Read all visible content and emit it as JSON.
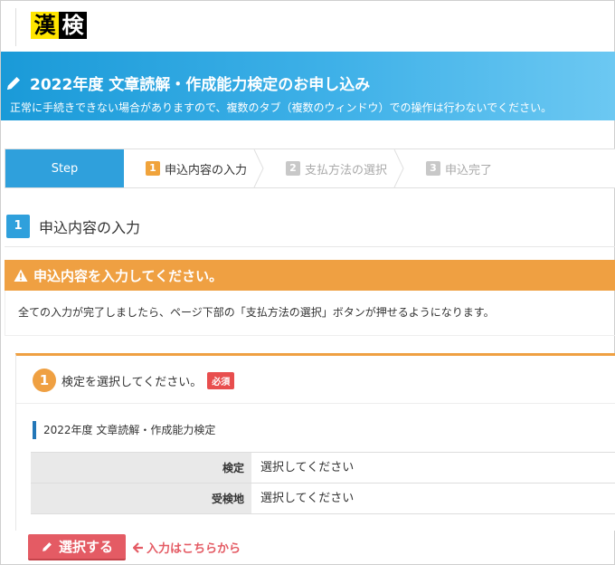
{
  "logo": {
    "char1": "漢",
    "char2": "検"
  },
  "banner": {
    "title": "2022年度 文章読解・作成能力検定のお申し込み",
    "note": "正常に手続きできない場合がありますので、複数のタブ（複数のウィンドウ）での操作は行わないでください。"
  },
  "steps": {
    "label": "Step",
    "items": [
      {
        "num": "1",
        "label": "申込内容の入力",
        "active": true
      },
      {
        "num": "2",
        "label": "支払方法の選択",
        "active": false
      },
      {
        "num": "3",
        "label": "申込完了",
        "active": false
      }
    ]
  },
  "section": {
    "num": "1",
    "title": "申込内容の入力"
  },
  "alert": {
    "title": "申込内容を入力してください。",
    "body": "全ての入力が完了しましたら、ページ下部の「支払方法の選択」ボタンが押せるようになります。"
  },
  "question": {
    "num": "1",
    "text": "検定を選択してください。",
    "required": "必須",
    "subtitle": "2022年度 文章読解・作成能力検定",
    "rows": [
      {
        "label": "検定",
        "value": "選択してください"
      },
      {
        "label": "受検地",
        "value": "選択してください"
      }
    ]
  },
  "actions": {
    "select_label": "選択する",
    "hint": "入力はこちらから"
  },
  "colors": {
    "brand_blue": "#2fa0dc",
    "accent_orange": "#efa042",
    "danger_red": "#e45b64"
  }
}
